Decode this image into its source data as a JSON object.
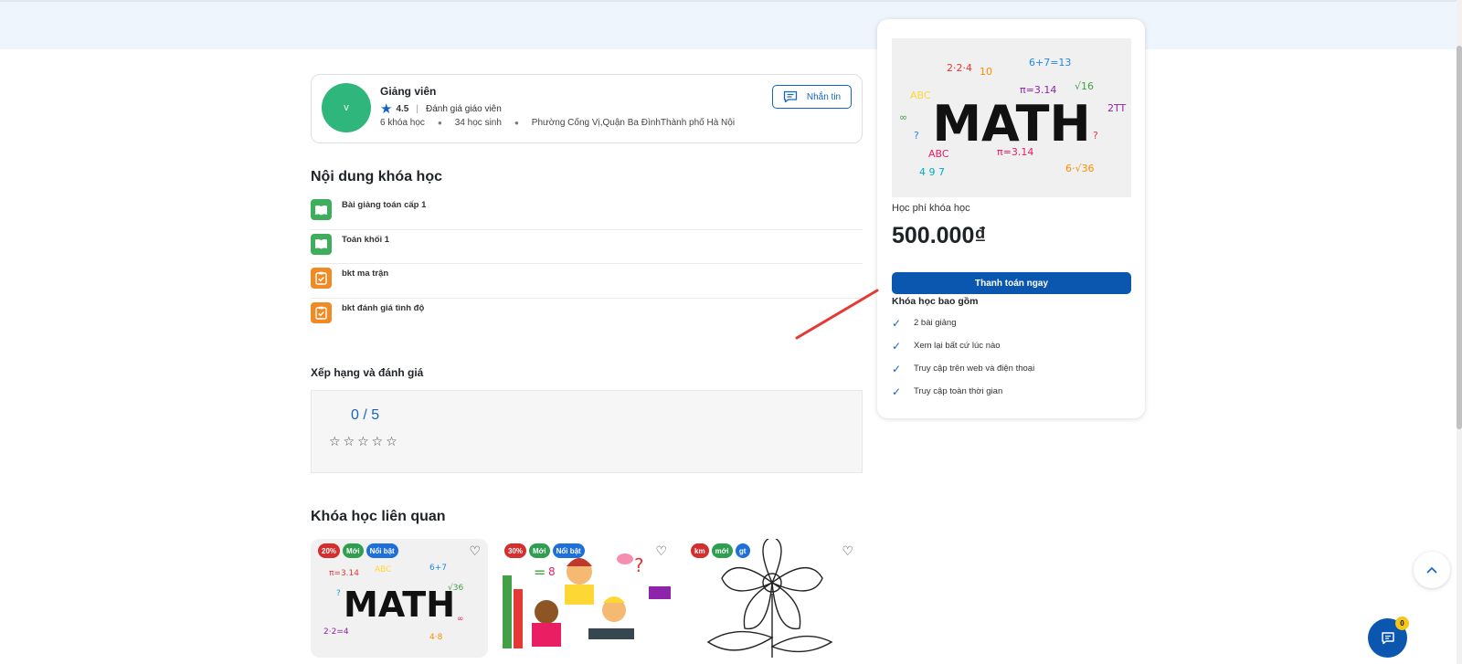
{
  "instructor": {
    "avatar_letter": "v",
    "role_title": "Giảng viên",
    "rating": "4.5",
    "rating_label": "Đánh giá giáo viên",
    "courses": "6 khóa học",
    "students": "34 học sinh",
    "address": "Phường Cống Vị,Quận Ba ĐìnhThành phố Hà Nội",
    "message_label": "Nhắn tin"
  },
  "content": {
    "title": "Nội dung khóa học",
    "items": [
      {
        "label": "Bài giảng toán cấp 1",
        "icon": "book-icon",
        "color": "#3eae5c"
      },
      {
        "label": "Toán khối 1",
        "icon": "book-icon",
        "color": "#3eae5c"
      },
      {
        "label": "bkt ma trận",
        "icon": "clipboard-check-icon",
        "color": "#f08a24"
      },
      {
        "label": "bkt đánh giá tình độ",
        "icon": "clipboard-check-icon",
        "color": "#f08a24"
      }
    ]
  },
  "rating": {
    "title": "Xếp hạng và đánh giá",
    "score": "0 / 5",
    "stars": "☆☆☆☆☆"
  },
  "related": {
    "title": "Khóa học liên quan",
    "cards": [
      {
        "badges": [
          "20%",
          "Mới",
          "Nổi bật"
        ],
        "image": "math-illustration"
      },
      {
        "badges": [
          "30%",
          "Mới",
          "Nổi bật"
        ],
        "image": "kids-reading-illustration"
      },
      {
        "badges": [
          "km",
          "mới",
          "gt"
        ],
        "image": "flower-line-drawing"
      }
    ]
  },
  "side": {
    "image_text": "MATH",
    "fee_label": "Học phí khóa học",
    "price": "500.000₫",
    "pay_label": "Thanh toán ngay",
    "includes_title": "Khóa học bao gồm",
    "includes": [
      "2 bài giảng",
      "Xem lại bất cứ lúc nào",
      "Truy cập trên web và điện thoại",
      "Truy cập toàn thời gian"
    ]
  },
  "chat": {
    "badge_count": "0"
  },
  "colors": {
    "primary": "#0b57b0",
    "accent_blue": "#1565c0",
    "avatar": "#2eb67d",
    "arrow": "#e53935"
  }
}
